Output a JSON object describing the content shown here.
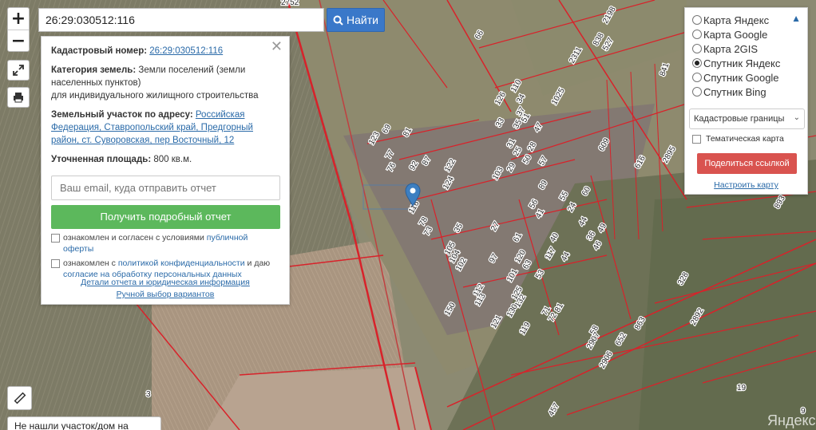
{
  "colors": {
    "accent": "#3a78c9",
    "report_button": "#5cb85c",
    "share_button": "#d9534f",
    "boundary": "#d8222a",
    "selected_parcel": "#3d7fc1"
  },
  "toolbar": {
    "zoom_in": "+",
    "zoom_out": "−",
    "expand_icon": "expand-icon",
    "print_icon": "print-icon",
    "ruler_icon": "ruler-icon"
  },
  "search": {
    "value": "26:29:030512:116",
    "button_label": "Найти",
    "button_icon": "search-icon"
  },
  "info": {
    "cadastral_label": "Кадастровый номер:",
    "cadastral_value": "26:29:030512:116",
    "category_label": "Категория земель:",
    "category_value": "Земли поселений (земли населенных пунктов)",
    "category_use": "для индивидуального жилищного строительства",
    "address_label": "Земельный участок по адресу:",
    "address_value": "Российская Федерация, Ставропольский край, Предгорный район, ст. Суворовская, пер Восточный, 12",
    "area_label": "Уточненная площадь:",
    "area_value": "800 кв.м.",
    "email_placeholder": "Ваш email, куда отправить отчет",
    "report_button": "Получить подробный отчет",
    "agree1_text": "ознакомлен и согласен с условиями",
    "agree1_link": "публичной оферты",
    "agree2_text": "ознакомлен с",
    "agree2_link": "политикой конфиденциальности",
    "agree2_mid": "и даю",
    "agree2_link2": "согласие на обработку персональных данных",
    "details_link": "Детали отчета и юридическая информация",
    "manual_link": "Ручной выбор вариантов"
  },
  "layers": {
    "options": [
      {
        "label": "Карта Яндекс",
        "selected": false
      },
      {
        "label": "Карта Google",
        "selected": false
      },
      {
        "label": "Карта 2GIS",
        "selected": false
      },
      {
        "label": "Спутник Яндекс",
        "selected": true
      },
      {
        "label": "Спутник Google",
        "selected": false
      },
      {
        "label": "Спутник Bing",
        "selected": false
      }
    ],
    "select_value": "Кадастровые границы",
    "thematic_label": "Тематическая карта",
    "share_button": "Поделиться ссылкой",
    "setup_link": "Настроить карту"
  },
  "help_tab": "Не нашли участок/дом на карте?",
  "attribution": "Яндекс",
  "map_labels": [
    "2752",
    "66",
    "2198",
    "838",
    "527",
    "2311",
    "841",
    "11",
    "1025",
    "126",
    "110",
    "34",
    "33",
    "37",
    "35",
    "47",
    "51",
    "31",
    "25",
    "28",
    "50",
    "57",
    "609",
    "2895",
    "616",
    "893",
    "116",
    "123",
    "69",
    "81",
    "77",
    "76",
    "92",
    "87",
    "122",
    "124",
    "103",
    "29",
    "89",
    "55",
    "56",
    "60",
    "78",
    "73",
    "35",
    "41",
    "24",
    "44",
    "105",
    "104",
    "102",
    "61",
    "27",
    "40",
    "36",
    "46",
    "49",
    "97",
    "101",
    "120",
    "63",
    "117",
    "44",
    "53",
    "112",
    "113",
    "132",
    "125",
    "130",
    "121",
    "119",
    "81",
    "71",
    "72",
    "150",
    "58",
    "863",
    "652",
    "2907",
    "2906",
    "328",
    "3",
    "19",
    "457",
    "2892",
    "9"
  ]
}
